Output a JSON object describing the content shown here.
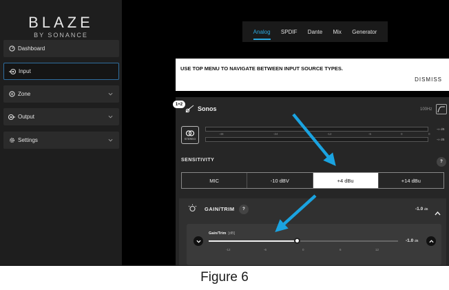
{
  "brand": {
    "name": "BLAZE",
    "sub": "BY SONANCE"
  },
  "sidebar": {
    "items": [
      {
        "label": "Dashboard",
        "icon": "dashboard-icon",
        "expandable": false,
        "active": false
      },
      {
        "label": "Input",
        "icon": "input-icon",
        "expandable": false,
        "active": true
      },
      {
        "label": "Zone",
        "icon": "zone-icon",
        "expandable": true,
        "active": false
      },
      {
        "label": "Output",
        "icon": "output-icon",
        "expandable": true,
        "active": false
      },
      {
        "label": "Settings",
        "icon": "gear-icon",
        "expandable": true,
        "active": false
      }
    ]
  },
  "tabs": [
    {
      "label": "Analog",
      "active": true
    },
    {
      "label": "SPDIF",
      "active": false
    },
    {
      "label": "Dante",
      "active": false
    },
    {
      "label": "Mix",
      "active": false
    },
    {
      "label": "Generator",
      "active": false
    }
  ],
  "banner": {
    "text": "USE TOP MENU TO NAVIGATE BETWEEN INPUT SOURCE TYPES.",
    "dismiss": "DISMISS"
  },
  "source": {
    "badge": "1+2",
    "name": "Sonos",
    "rate": "100Hz"
  },
  "meter": {
    "stereo_label": "STEREO",
    "ticks": [
      "-48",
      "-24",
      "-12",
      "-6",
      "0"
    ],
    "right_tick": "0",
    "levels": [
      "-∞ dB",
      "-∞ dB"
    ]
  },
  "sensitivity": {
    "label": "SENSITIVITY",
    "help": "?",
    "options": [
      "MIC",
      "-10 dBV",
      "+4 dBu",
      "+14 dBu"
    ],
    "selected": 2
  },
  "gain": {
    "title": "GAIN/TRIM",
    "help": "?",
    "value_text": "-1.0",
    "unit": "dB",
    "slider_label": "Gain/Trim",
    "slider_unit": "[dB]",
    "slider_value": "-1.0",
    "slider_value_unit": "dB",
    "slider_min": -15,
    "slider_max": 15,
    "slider_current": -1.0,
    "ticks": [
      "-12",
      "-6",
      "0",
      "6",
      "12"
    ]
  },
  "caption": "Figure 6",
  "colors": {
    "accent": "#2ba8e0",
    "sidebar": "#1e1e1e",
    "arrow": "#1aa3e0"
  }
}
